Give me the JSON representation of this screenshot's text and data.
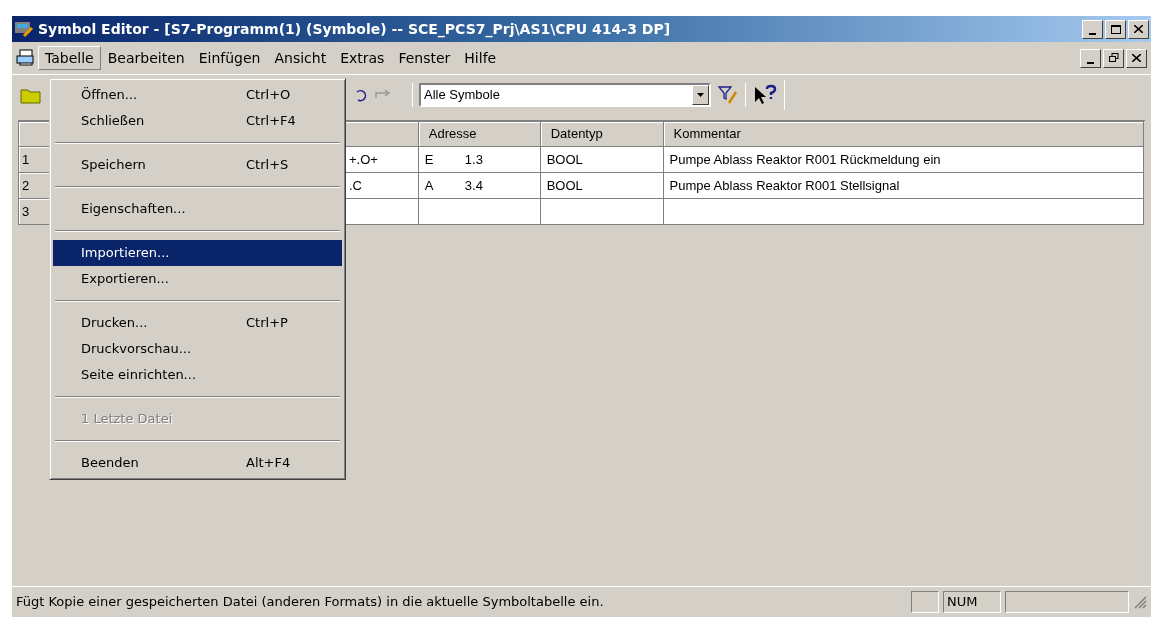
{
  "window": {
    "title": "Symbol Editor - [S7-Programm(1) (Symbole) -- SCE_PCS7_Prj\\AS1\\CPU 414-3 DP]"
  },
  "menu_bar": [
    {
      "label": "Tabelle",
      "selected": true
    },
    {
      "label": "Bearbeiten",
      "selected": false
    },
    {
      "label": "Einfügen",
      "selected": false
    },
    {
      "label": "Ansicht",
      "selected": false
    },
    {
      "label": "Extras",
      "selected": false
    },
    {
      "label": "Fenster",
      "selected": false
    },
    {
      "label": "Hilfe",
      "selected": false
    }
  ],
  "toolbar": {
    "filter": {
      "value": "Alle Symbole"
    }
  },
  "table": {
    "columns": [
      "",
      "",
      "Adresse",
      "Datentyp",
      "Kommentar"
    ],
    "rows": [
      {
        "number": "1",
        "symbol": "+.O+",
        "address_area": "E",
        "address": "1.3",
        "datatype": "BOOL",
        "comment": "Pumpe Ablass Reaktor R001 Rückmeldung ein"
      },
      {
        "number": "2",
        "symbol": ".C",
        "address_area": "A",
        "address": "3.4",
        "datatype": "BOOL",
        "comment": "Pumpe Ablass Reaktor R001 Stellsignal"
      },
      {
        "number": "3",
        "symbol": "",
        "address_area": "",
        "address": "",
        "datatype": "",
        "comment": ""
      }
    ]
  },
  "menu": {
    "items": [
      {
        "kind": "item",
        "label": "Öffnen...",
        "shortcut": "Ctrl+O",
        "selected": false,
        "disabled": false
      },
      {
        "kind": "item",
        "label": "Schließen",
        "shortcut": "Ctrl+F4",
        "selected": false,
        "disabled": false
      },
      {
        "kind": "separator"
      },
      {
        "kind": "item",
        "label": "Speichern",
        "shortcut": "Ctrl+S",
        "selected": false,
        "disabled": false
      },
      {
        "kind": "separator"
      },
      {
        "kind": "item",
        "label": "Eigenschaften...",
        "selected": false,
        "disabled": false
      },
      {
        "kind": "separator"
      },
      {
        "kind": "item",
        "label": "Importieren...",
        "selected": true,
        "disabled": false
      },
      {
        "kind": "item",
        "label": "Exportieren...",
        "selected": false,
        "disabled": false
      },
      {
        "kind": "separator"
      },
      {
        "kind": "item",
        "label": "Drucken...",
        "shortcut": "Ctrl+P",
        "selected": false,
        "disabled": false
      },
      {
        "kind": "item",
        "label": "Druckvorschau...",
        "selected": false,
        "disabled": false
      },
      {
        "kind": "item",
        "label": "Seite einrichten...",
        "selected": false,
        "disabled": false
      },
      {
        "kind": "separator"
      },
      {
        "kind": "item",
        "label": "1 Letzte Datei",
        "selected": false,
        "disabled": true
      },
      {
        "kind": "separator"
      },
      {
        "kind": "item",
        "label": "Beenden",
        "shortcut": "Alt+F4",
        "selected": false,
        "disabled": false
      }
    ]
  },
  "status_bar": {
    "message": "Fügt Kopie einer gespeicherten Datei (anderen Formats) in die aktuelle Symboltabelle ein.",
    "num": "NUM"
  }
}
